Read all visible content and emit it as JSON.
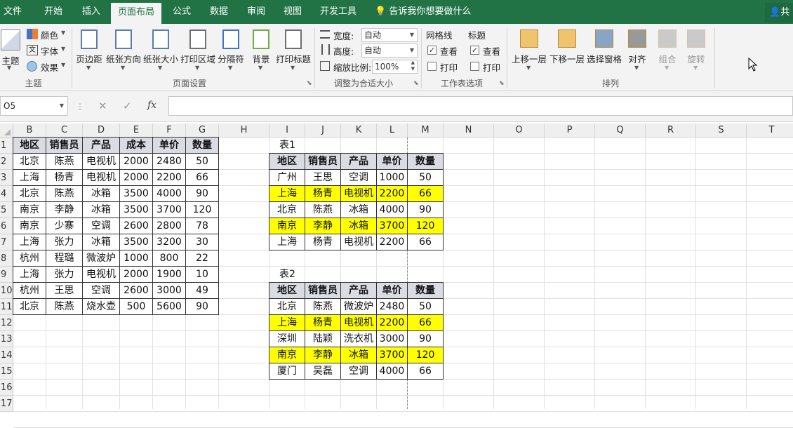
{
  "ribbon_tabs": [
    "文件",
    "开始",
    "插入",
    "页面布局",
    "公式",
    "数据",
    "审阅",
    "视图",
    "开发工具"
  ],
  "active_tab": "页面布局",
  "tell_me": "告诉我你想要做什么",
  "share_label": "共",
  "ribbon": {
    "theme_group": {
      "label": "主题",
      "btn": "主题",
      "colors": "颜色",
      "fonts": "字体",
      "effects": "效果"
    },
    "page_setup_group": {
      "label": "页面设置",
      "buttons": [
        "页边距",
        "纸张方向",
        "纸张大小",
        "打印区域",
        "分隔符",
        "背景",
        "打印标题"
      ]
    },
    "scale_group": {
      "label": "调整为合适大小",
      "width_label": "宽度:",
      "width_value": "自动",
      "height_label": "高度:",
      "height_value": "自动",
      "scale_label": "缩放比例:",
      "scale_value": "100%"
    },
    "sheet_options_group": {
      "label": "工作表选项",
      "gridlines": "网格线",
      "headings": "标题",
      "view": "查看",
      "print": "打印"
    },
    "arrange_group": {
      "label": "排列",
      "buttons": [
        "上移一层",
        "下移一层",
        "选择窗格",
        "对齐",
        "组合",
        "旋转"
      ]
    }
  },
  "formula_bar": {
    "name_box": "O5",
    "fx": "fx",
    "formula": ""
  },
  "columns": [
    "B",
    "C",
    "D",
    "E",
    "F",
    "G",
    "H",
    "I",
    "J",
    "K",
    "L",
    "M",
    "N",
    "O",
    "P",
    "Q",
    "R",
    "S",
    "T"
  ],
  "rows": [
    "1",
    "2",
    "3",
    "4",
    "5",
    "6",
    "7",
    "8",
    "9",
    "10",
    "11",
    "12",
    "13",
    "14",
    "15",
    "16",
    "17"
  ],
  "main_table": {
    "headers": [
      "地区",
      "销售员",
      "产品",
      "成本",
      "单价",
      "数量"
    ],
    "rows": [
      [
        "北京",
        "陈燕",
        "电视机",
        "2000",
        "2480",
        "50"
      ],
      [
        "上海",
        "杨青",
        "电视机",
        "2000",
        "2200",
        "66"
      ],
      [
        "北京",
        "陈燕",
        "冰箱",
        "3500",
        "4000",
        "90"
      ],
      [
        "南京",
        "李静",
        "冰箱",
        "3500",
        "3700",
        "120"
      ],
      [
        "南京",
        "少寨",
        "空调",
        "2600",
        "2800",
        "78"
      ],
      [
        "上海",
        "张力",
        "冰箱",
        "3500",
        "3200",
        "30"
      ],
      [
        "杭州",
        "程璐",
        "微波炉",
        "1000",
        "800",
        "22"
      ],
      [
        "上海",
        "张力",
        "电视机",
        "2000",
        "1900",
        "10"
      ],
      [
        "杭州",
        "王思",
        "空调",
        "2600",
        "3000",
        "49"
      ],
      [
        "北京",
        "陈燕",
        "烧水壶",
        "500",
        "5600",
        "90"
      ]
    ]
  },
  "table1": {
    "title": "表1",
    "headers": [
      "地区",
      "销售员",
      "产品",
      "单价",
      "数量"
    ],
    "rows": [
      [
        "广州",
        "王思",
        "空调",
        "1000",
        "50"
      ],
      [
        "上海",
        "杨青",
        "电视机",
        "2200",
        "66"
      ],
      [
        "北京",
        "陈燕",
        "冰箱",
        "4000",
        "90"
      ],
      [
        "南京",
        "李静",
        "冰箱",
        "3700",
        "120"
      ],
      [
        "上海",
        "杨青",
        "电视机",
        "2200",
        "66"
      ]
    ],
    "highlight": [
      1,
      3
    ]
  },
  "table2": {
    "title": "表2",
    "headers": [
      "地区",
      "销售员",
      "产品",
      "单价",
      "数量"
    ],
    "rows": [
      [
        "北京",
        "陈燕",
        "微波炉",
        "2480",
        "50"
      ],
      [
        "上海",
        "杨青",
        "电视机",
        "2200",
        "66"
      ],
      [
        "深圳",
        "陆颖",
        "洗衣机",
        "3000",
        "90"
      ],
      [
        "南京",
        "李静",
        "冰箱",
        "3700",
        "120"
      ],
      [
        "厦门",
        "吴磊",
        "空调",
        "4000",
        "66"
      ]
    ],
    "highlight": [
      1,
      3
    ]
  },
  "colors": {
    "excel_green": "#217346",
    "highlight": "#ffff00",
    "header_fill": "#d9dce3"
  }
}
